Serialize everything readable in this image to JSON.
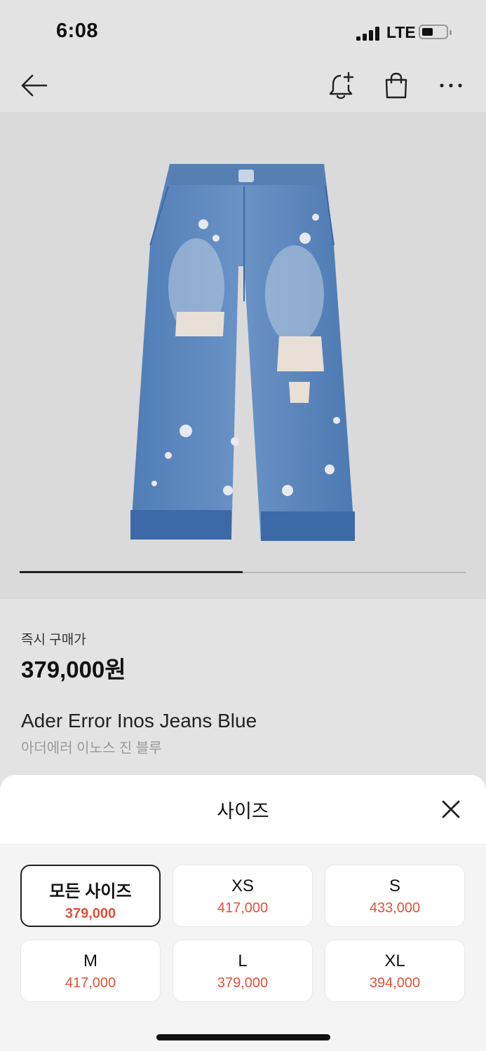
{
  "status_bar": {
    "time": "6:08",
    "network": "LTE"
  },
  "nav": {
    "back_icon": "back-arrow-icon",
    "actions": [
      "bell-plus-icon",
      "shopping-bag-icon",
      "more-icon"
    ]
  },
  "product": {
    "image_icon": "jeans-image",
    "gallery_progress": 0.5,
    "price_label": "즉시 구매가",
    "price": "379,000원",
    "name_en": "Ader Error Inos Jeans Blue",
    "name_ko": "아더에러 이노스 진 블루"
  },
  "size_sheet": {
    "title": "사이즈",
    "close_icon": "close-icon",
    "sizes": [
      {
        "size": "모든 사이즈",
        "price": "379,000",
        "selected": true
      },
      {
        "size": "XS",
        "price": "417,000",
        "selected": false
      },
      {
        "size": "S",
        "price": "433,000",
        "selected": false
      },
      {
        "size": "M",
        "price": "417,000",
        "selected": false
      },
      {
        "size": "L",
        "price": "379,000",
        "selected": false
      },
      {
        "size": "XL",
        "price": "394,000",
        "selected": false
      }
    ]
  },
  "colors": {
    "price_accent": "#e0513c",
    "hero_bg": "#dadada",
    "denim": "#5b86bd"
  }
}
